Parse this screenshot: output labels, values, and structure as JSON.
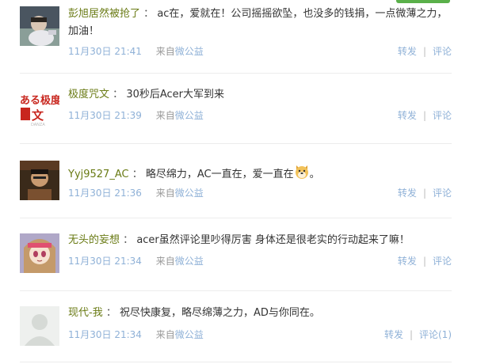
{
  "colors": {
    "username": "#6a7b15",
    "link_blue": "#8fb1d7",
    "meta_gray": "#999999",
    "divider": "#ececec",
    "accent_green": "#5ab04a"
  },
  "comments": [
    {
      "username": "彭旭居然被抢了",
      "colon": "：",
      "content": "ac在，爱就在！公司摇摇欲坠，也没多的钱捐，一点微薄之力，加油！",
      "time": "11月30日 21:41",
      "from_label": "来自",
      "app": "微公益",
      "forward_label": "转发",
      "separator": "|",
      "comment_label": "评论",
      "avatar_icon": "child-photo-avatar"
    },
    {
      "username": "极度咒文",
      "colon": "：",
      "content": "30秒后Acer大军到来",
      "time": "11月30日 21:39",
      "from_label": "来自",
      "app": "微公益",
      "forward_label": "转发",
      "separator": "|",
      "comment_label": "评论",
      "avatar_icon": "red-text-logo-avatar",
      "avatar_text_top": "ある极度",
      "avatar_text_bottom": "文",
      "avatar_text_small": "DANZA"
    },
    {
      "username": "Yyj9527_AC",
      "colon": "：",
      "content": "略尽绵力，AC一直在，爱一直在",
      "content_tail": "。",
      "time": "11月30日 21:36",
      "from_label": "来自",
      "app": "微公益",
      "forward_label": "转发",
      "separator": "|",
      "comment_label": "评论",
      "avatar_icon": "person-photo-avatar",
      "emoji_icon": "doge-emoji-icon"
    },
    {
      "username": "无头的妄想",
      "colon": "：",
      "content": "acer虽然评论里吵得厉害 身体还是很老实的行动起来了嘛！",
      "time": "11月30日 21:34",
      "from_label": "来自",
      "app": "微公益",
      "forward_label": "转发",
      "separator": "|",
      "comment_label": "评论",
      "avatar_icon": "anime-girl-avatar"
    },
    {
      "username": "现代-我",
      "colon": "：",
      "content": "祝尽快康复，略尽绵薄之力，AD与你同在。",
      "time": "11月30日 21:34",
      "from_label": "来自",
      "app": "微公益",
      "forward_label": "转发",
      "separator": "|",
      "comment_label": "评论(1)",
      "avatar_icon": "default-silhouette-avatar"
    }
  ]
}
